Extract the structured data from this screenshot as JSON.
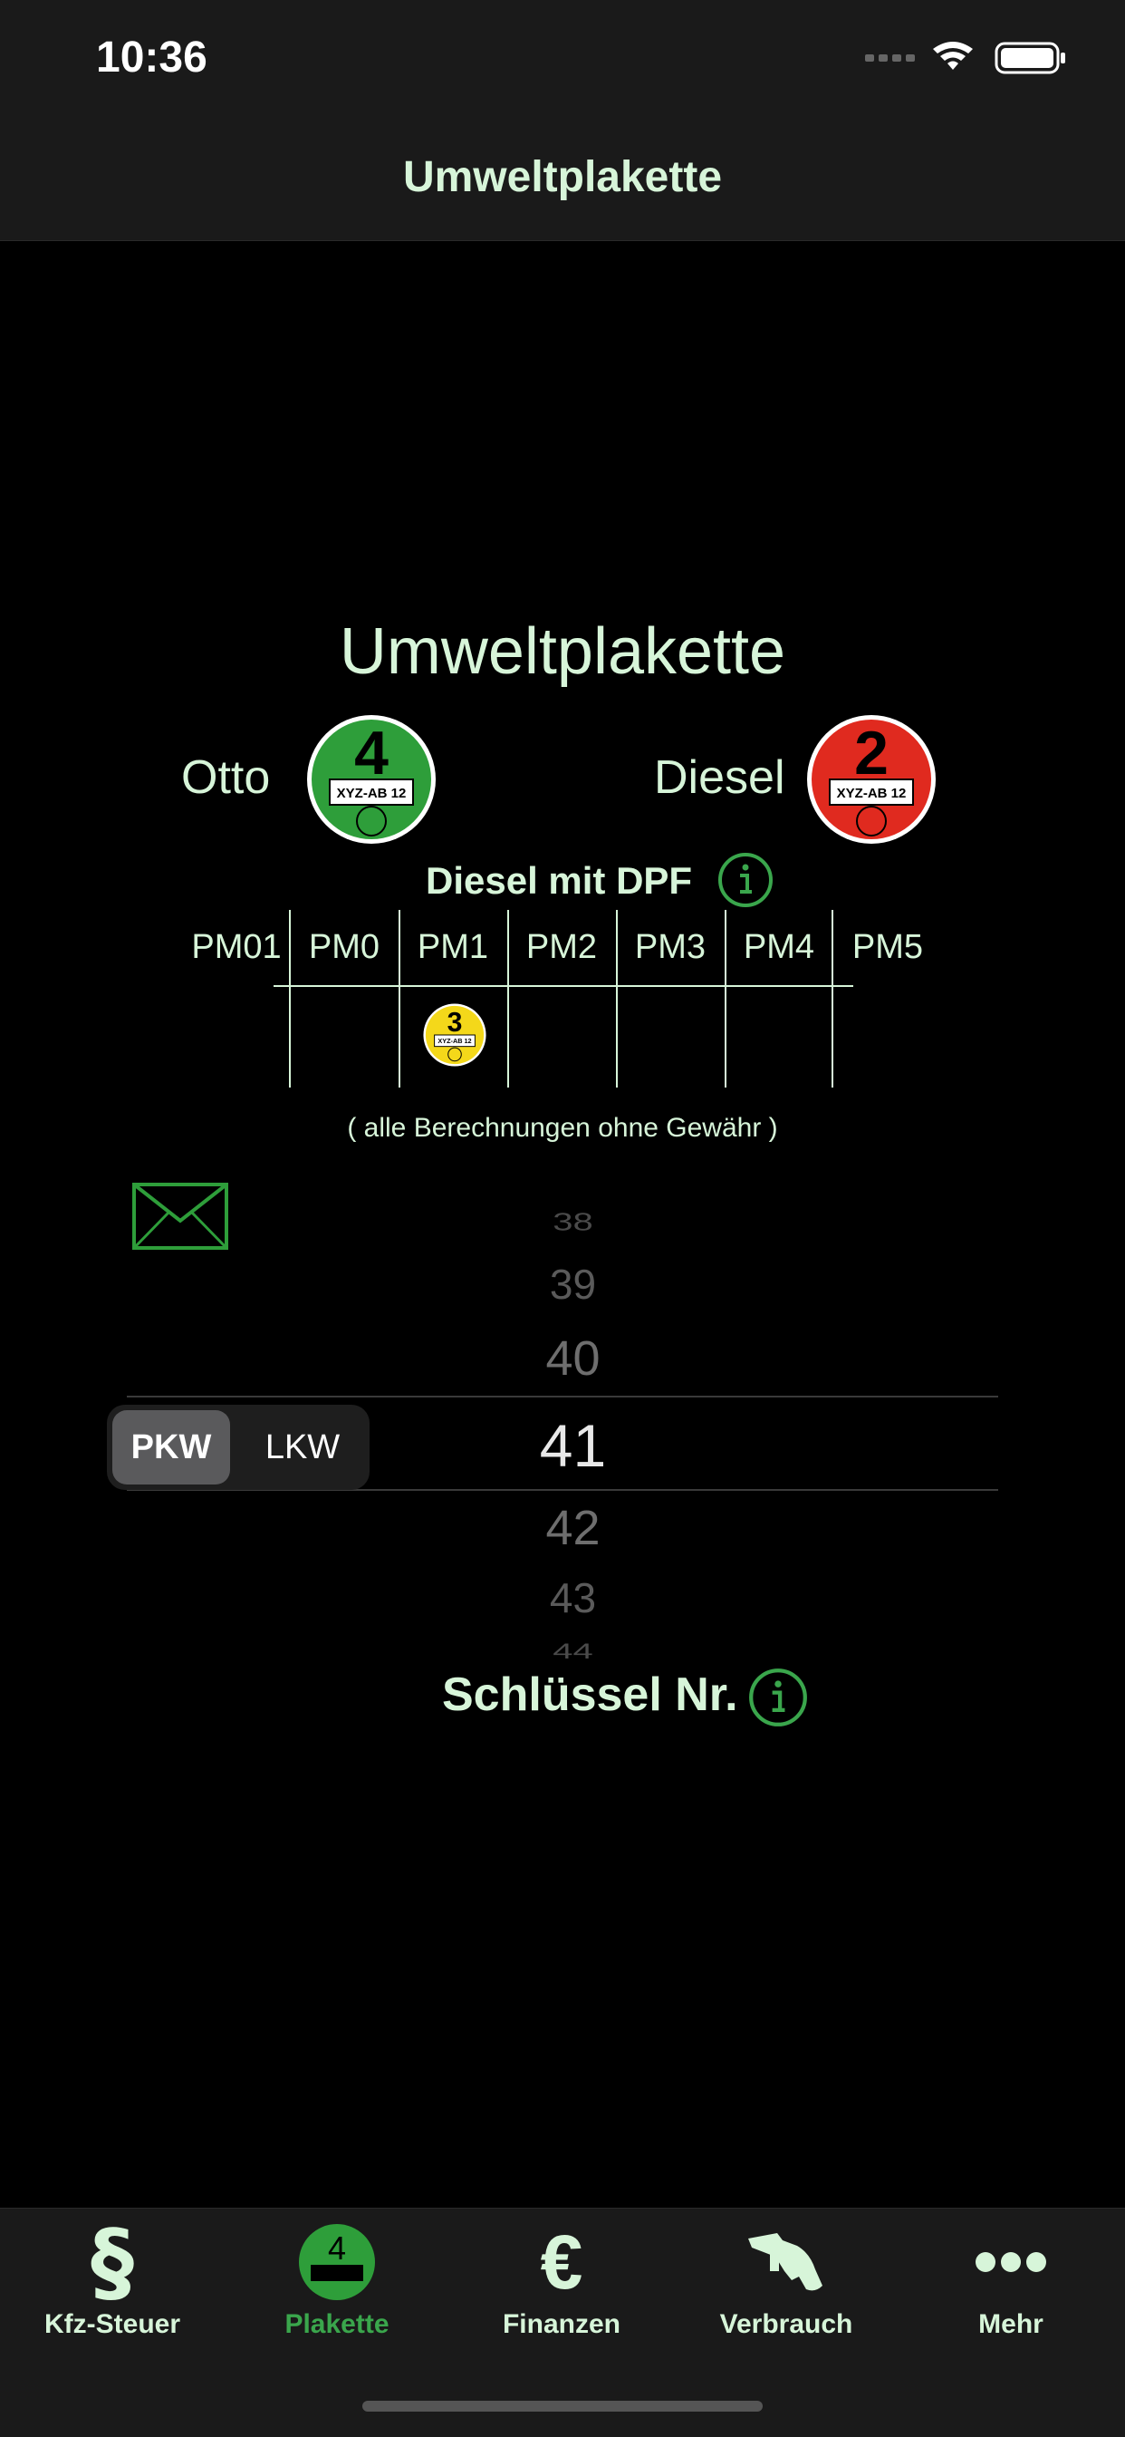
{
  "status": {
    "time": "10:36"
  },
  "nav": {
    "title": "Umweltplakette"
  },
  "main": {
    "title": "Umweltplakette",
    "otto_label": "Otto",
    "diesel_label": "Diesel",
    "otto_badge": {
      "number": "4",
      "plate": "XYZ-AB 12",
      "color": "#2e9e3a"
    },
    "diesel_badge": {
      "number": "2",
      "plate": "XYZ-AB 12",
      "color": "#e02a1f"
    },
    "dpf_title": "Diesel mit DPF",
    "pm_classes": [
      "PM01",
      "PM0",
      "PM1",
      "PM2",
      "PM3",
      "PM4",
      "PM5"
    ],
    "dpf_badge": {
      "number": "3",
      "plate": "XYZ-AB 12",
      "color": "#f4d81a",
      "class": "PM1"
    },
    "disclaimer": "( alle Berechnungen ohne Gewähr )"
  },
  "picker": {
    "values": [
      "38",
      "39",
      "40",
      "41",
      "42",
      "43",
      "44"
    ],
    "selected": "41",
    "label": "Schlüssel Nr."
  },
  "segment": {
    "options": [
      "PKW",
      "LKW"
    ],
    "selected": "PKW"
  },
  "tabs": [
    {
      "label": "Kfz-Steuer",
      "icon": "paragraph-icon"
    },
    {
      "label": "Plakette",
      "icon": "plakette-icon",
      "active": true
    },
    {
      "label": "Finanzen",
      "icon": "euro-icon"
    },
    {
      "label": "Verbrauch",
      "icon": "fuel-nozzle-icon"
    },
    {
      "label": "Mehr",
      "icon": "more-dots-icon"
    }
  ],
  "colors": {
    "accent": "#3aa64c",
    "text": "#d7f5d9",
    "background": "#000000"
  }
}
